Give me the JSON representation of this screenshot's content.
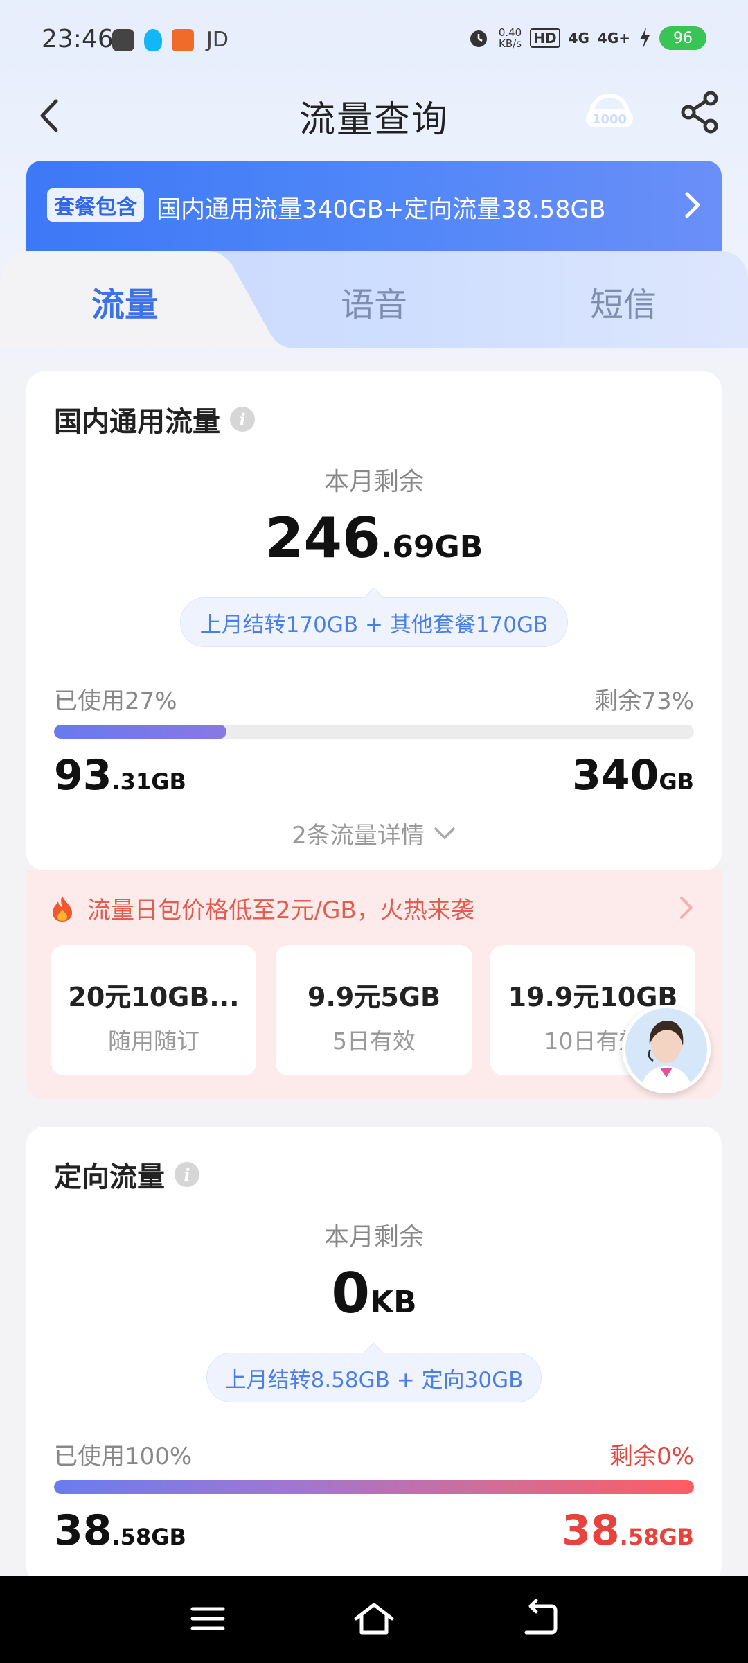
{
  "status_bar": {
    "time": "23:46",
    "carrier_text": "JD",
    "net_speed_value": "0.40",
    "net_speed_unit": "KB/s",
    "hd_label": "HD",
    "network_1": "4G",
    "network_2": "4G+",
    "battery": "96"
  },
  "header": {
    "title": "流量查询",
    "service_icon": "headset-1000-icon",
    "share_icon": "share-icon"
  },
  "package": {
    "badge": "套餐包含",
    "text": "国内通用流量340GB+定向流量38.58GB"
  },
  "tabs": [
    {
      "label": "流量",
      "active": true
    },
    {
      "label": "语音",
      "active": false
    },
    {
      "label": "短信",
      "active": false
    }
  ],
  "general_data": {
    "title": "国内通用流量",
    "remain_label": "本月剩余",
    "remain_int": "246",
    "remain_dec": ".69GB",
    "carry_note": "上月结转170GB + 其他套餐170GB",
    "used_label": "已使用27%",
    "left_label": "剩余73%",
    "used_fraction": 0.27,
    "used_int": "93",
    "used_dec": ".31GB",
    "total_int": "340",
    "total_dec": "GB",
    "detail_link": "2条流量详情"
  },
  "promo": {
    "headline": "流量日包价格低至2元/GB，火热来袭",
    "offers": [
      {
        "title": "20元10GB...",
        "subtitle": "随用随订"
      },
      {
        "title": "9.9元5GB",
        "subtitle": "5日有效"
      },
      {
        "title": "19.9元10GB",
        "subtitle": "10日有效"
      }
    ]
  },
  "directed_data": {
    "title": "定向流量",
    "remain_label": "本月剩余",
    "remain_int": "0",
    "remain_dec": "KB",
    "carry_note": "上月结转8.58GB + 定向30GB",
    "used_label": "已使用100%",
    "left_label": "剩余0%",
    "used_fraction": 1.0,
    "used_int": "38",
    "used_dec": ".58GB",
    "total_int": "38",
    "total_dec": ".58GB"
  },
  "colors": {
    "accent": "#3b72e8",
    "alert": "#e8423c"
  }
}
